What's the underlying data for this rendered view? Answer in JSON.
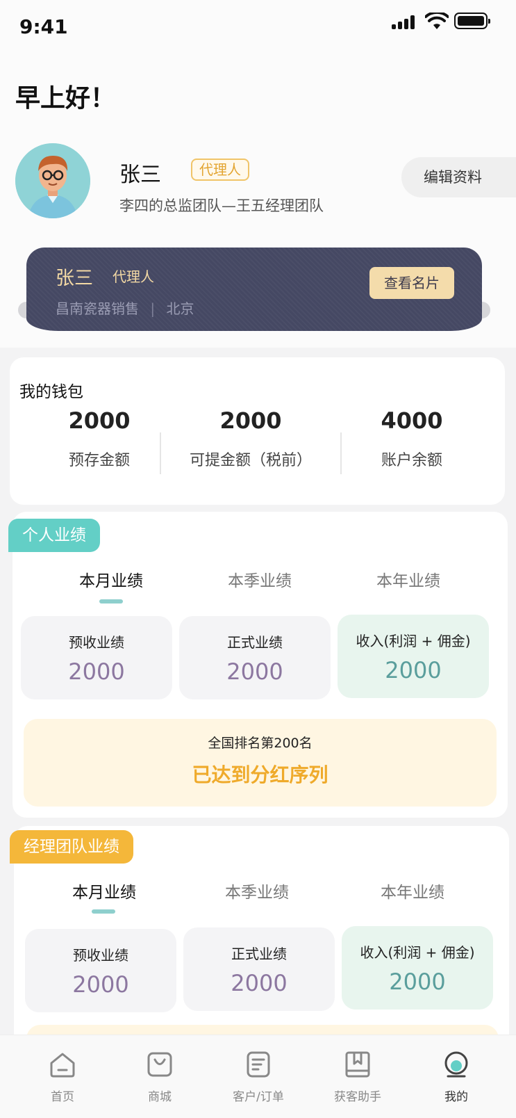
{
  "status_bar": {
    "time": "9:41"
  },
  "greeting": "早上好！",
  "profile": {
    "name": "张三",
    "role_tag": "代理人",
    "team": "李四的总监团队—王五经理团队",
    "edit_label": "编辑资料"
  },
  "business_card": {
    "name": "张三",
    "role": "代理人",
    "company": "昌南瓷器销售",
    "city": "北京",
    "separator": "|",
    "view_label": "查看名片"
  },
  "wallet": {
    "title": "我的钱包",
    "stats": [
      {
        "value": "2000",
        "label": "预存金额"
      },
      {
        "value": "2000",
        "label": "可提金额（税前）"
      },
      {
        "value": "4000",
        "label": "账户余额"
      }
    ]
  },
  "personal": {
    "tag": "个人业绩",
    "tabs": [
      "本月业绩",
      "本季业绩",
      "本年业绩"
    ],
    "active_tab": 0,
    "stats": [
      {
        "label": "预收业绩",
        "value": "2000"
      },
      {
        "label": "正式业绩",
        "value": "2000"
      },
      {
        "label": "收入(利润 + 佣金)",
        "value": "2000"
      }
    ],
    "rank_line": "全国排名第200名",
    "rank_status": "已达到分红序列"
  },
  "manager": {
    "tag": "经理团队业绩",
    "tabs": [
      "本月业绩",
      "本季业绩",
      "本年业绩"
    ],
    "active_tab": 0,
    "stats": [
      {
        "label": "预收业绩",
        "value": "2000"
      },
      {
        "label": "正式业绩",
        "value": "2000"
      },
      {
        "label": "收入(利润 + 佣金)",
        "value": "2000"
      }
    ]
  },
  "tabbar": {
    "items": [
      {
        "label": "首页",
        "icon": "home-icon"
      },
      {
        "label": "商城",
        "icon": "shopping-bag-icon"
      },
      {
        "label": "客户/订单",
        "icon": "document-list-icon"
      },
      {
        "label": "获客助手",
        "icon": "book-icon"
      },
      {
        "label": "我的",
        "icon": "profile-icon"
      }
    ],
    "active_index": 4
  },
  "colors": {
    "teal_tag": "#63cfc6",
    "orange_tag": "#f4b73a",
    "card_bg": "#454863",
    "card_text": "#f3d9a4",
    "value_purple": "#8c77a0",
    "value_green": "#5a9e9c"
  }
}
